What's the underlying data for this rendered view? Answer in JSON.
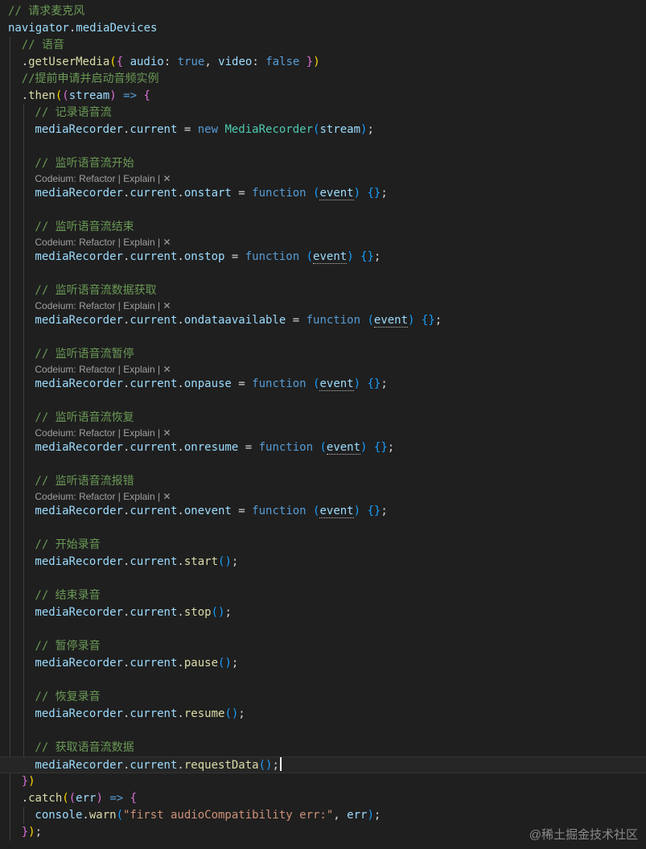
{
  "editor": {
    "lines": [
      {
        "kind": "code",
        "indent": 0,
        "tokens": [
          [
            "t-comment",
            "// 请求麦克风"
          ]
        ]
      },
      {
        "kind": "code",
        "indent": 0,
        "tokens": [
          [
            "t-var",
            "navigator"
          ],
          [
            "t-op",
            "."
          ],
          [
            "t-prop",
            "mediaDevices"
          ]
        ]
      },
      {
        "kind": "code",
        "indent": 1,
        "tokens": [
          [
            "t-comment",
            "// 语音"
          ]
        ]
      },
      {
        "kind": "code",
        "indent": 1,
        "tokens": [
          [
            "t-op",
            "."
          ],
          [
            "t-fn",
            "getUserMedia"
          ],
          [
            "t-b1",
            "("
          ],
          [
            "t-b2",
            "{ "
          ],
          [
            "t-prop",
            "audio"
          ],
          [
            "t-op",
            ": "
          ],
          [
            "t-kw",
            "true"
          ],
          [
            "t-op",
            ", "
          ],
          [
            "t-prop",
            "video"
          ],
          [
            "t-op",
            ": "
          ],
          [
            "t-kw",
            "false"
          ],
          [
            "t-b2",
            " }"
          ],
          [
            "t-b1",
            ")"
          ]
        ]
      },
      {
        "kind": "code",
        "indent": 1,
        "tokens": [
          [
            "t-comment",
            "//提前申请并启动音频实例"
          ]
        ]
      },
      {
        "kind": "code",
        "indent": 1,
        "tokens": [
          [
            "t-op",
            "."
          ],
          [
            "t-fn",
            "then"
          ],
          [
            "t-b1",
            "("
          ],
          [
            "t-b2",
            "("
          ],
          [
            "t-param",
            "stream"
          ],
          [
            "t-b2",
            ")"
          ],
          [
            "t-kw",
            " => "
          ],
          [
            "t-b2",
            "{"
          ]
        ]
      },
      {
        "kind": "code",
        "indent": 2,
        "tokens": [
          [
            "t-comment",
            "// 记录语音流"
          ]
        ]
      },
      {
        "kind": "code",
        "indent": 2,
        "tokens": [
          [
            "t-var",
            "mediaRecorder"
          ],
          [
            "t-op",
            "."
          ],
          [
            "t-prop",
            "current"
          ],
          [
            "t-op",
            " = "
          ],
          [
            "t-kw",
            "new "
          ],
          [
            "t-type",
            "MediaRecorder"
          ],
          [
            "t-b3",
            "("
          ],
          [
            "t-var",
            "stream"
          ],
          [
            "t-b3",
            ")"
          ],
          [
            "t-op",
            ";"
          ]
        ]
      },
      {
        "kind": "blank",
        "indent": 2
      },
      {
        "kind": "code",
        "indent": 2,
        "tokens": [
          [
            "t-comment",
            "// 监听语音流开始"
          ]
        ]
      },
      {
        "kind": "lens",
        "indent": 2
      },
      {
        "kind": "code",
        "indent": 2,
        "tokens": [
          [
            "t-var",
            "mediaRecorder"
          ],
          [
            "t-op",
            "."
          ],
          [
            "t-prop",
            "current"
          ],
          [
            "t-op",
            "."
          ],
          [
            "t-prop",
            "onstart"
          ],
          [
            "t-op",
            " = "
          ],
          [
            "t-kw",
            "function "
          ],
          [
            "t-b3",
            "("
          ],
          [
            "t-hint",
            "event"
          ],
          [
            "t-b3",
            ")"
          ],
          [
            "t-op",
            " "
          ],
          [
            "t-b3",
            "{}"
          ],
          [
            "t-op",
            ";"
          ]
        ]
      },
      {
        "kind": "blank",
        "indent": 2
      },
      {
        "kind": "code",
        "indent": 2,
        "tokens": [
          [
            "t-comment",
            "// 监听语音流结束"
          ]
        ]
      },
      {
        "kind": "lens",
        "indent": 2
      },
      {
        "kind": "code",
        "indent": 2,
        "tokens": [
          [
            "t-var",
            "mediaRecorder"
          ],
          [
            "t-op",
            "."
          ],
          [
            "t-prop",
            "current"
          ],
          [
            "t-op",
            "."
          ],
          [
            "t-prop",
            "onstop"
          ],
          [
            "t-op",
            " = "
          ],
          [
            "t-kw",
            "function "
          ],
          [
            "t-b3",
            "("
          ],
          [
            "t-hint",
            "event"
          ],
          [
            "t-b3",
            ")"
          ],
          [
            "t-op",
            " "
          ],
          [
            "t-b3",
            "{}"
          ],
          [
            "t-op",
            ";"
          ]
        ]
      },
      {
        "kind": "blank",
        "indent": 2
      },
      {
        "kind": "code",
        "indent": 2,
        "tokens": [
          [
            "t-comment",
            "// 监听语音流数据获取"
          ]
        ]
      },
      {
        "kind": "lens",
        "indent": 2
      },
      {
        "kind": "code",
        "indent": 2,
        "tokens": [
          [
            "t-var",
            "mediaRecorder"
          ],
          [
            "t-op",
            "."
          ],
          [
            "t-prop",
            "current"
          ],
          [
            "t-op",
            "."
          ],
          [
            "t-prop",
            "ondataavailable"
          ],
          [
            "t-op",
            " = "
          ],
          [
            "t-kw",
            "function "
          ],
          [
            "t-b3",
            "("
          ],
          [
            "t-hint",
            "event"
          ],
          [
            "t-b3",
            ")"
          ],
          [
            "t-op",
            " "
          ],
          [
            "t-b3",
            "{}"
          ],
          [
            "t-op",
            ";"
          ]
        ]
      },
      {
        "kind": "blank",
        "indent": 2
      },
      {
        "kind": "code",
        "indent": 2,
        "tokens": [
          [
            "t-comment",
            "// 监听语音流暂停"
          ]
        ]
      },
      {
        "kind": "lens",
        "indent": 2
      },
      {
        "kind": "code",
        "indent": 2,
        "tokens": [
          [
            "t-var",
            "mediaRecorder"
          ],
          [
            "t-op",
            "."
          ],
          [
            "t-prop",
            "current"
          ],
          [
            "t-op",
            "."
          ],
          [
            "t-prop",
            "onpause"
          ],
          [
            "t-op",
            " = "
          ],
          [
            "t-kw",
            "function "
          ],
          [
            "t-b3",
            "("
          ],
          [
            "t-hint",
            "event"
          ],
          [
            "t-b3",
            ")"
          ],
          [
            "t-op",
            " "
          ],
          [
            "t-b3",
            "{}"
          ],
          [
            "t-op",
            ";"
          ]
        ]
      },
      {
        "kind": "blank",
        "indent": 2
      },
      {
        "kind": "code",
        "indent": 2,
        "tokens": [
          [
            "t-comment",
            "// 监听语音流恢复"
          ]
        ]
      },
      {
        "kind": "lens",
        "indent": 2
      },
      {
        "kind": "code",
        "indent": 2,
        "tokens": [
          [
            "t-var",
            "mediaRecorder"
          ],
          [
            "t-op",
            "."
          ],
          [
            "t-prop",
            "current"
          ],
          [
            "t-op",
            "."
          ],
          [
            "t-prop",
            "onresume"
          ],
          [
            "t-op",
            " = "
          ],
          [
            "t-kw",
            "function "
          ],
          [
            "t-b3",
            "("
          ],
          [
            "t-hint",
            "event"
          ],
          [
            "t-b3",
            ")"
          ],
          [
            "t-op",
            " "
          ],
          [
            "t-b3",
            "{}"
          ],
          [
            "t-op",
            ";"
          ]
        ]
      },
      {
        "kind": "blank",
        "indent": 2
      },
      {
        "kind": "code",
        "indent": 2,
        "tokens": [
          [
            "t-comment",
            "// 监听语音流报错"
          ]
        ]
      },
      {
        "kind": "lens",
        "indent": 2
      },
      {
        "kind": "code",
        "indent": 2,
        "tokens": [
          [
            "t-var",
            "mediaRecorder"
          ],
          [
            "t-op",
            "."
          ],
          [
            "t-prop",
            "current"
          ],
          [
            "t-op",
            "."
          ],
          [
            "t-prop",
            "onevent"
          ],
          [
            "t-op",
            " = "
          ],
          [
            "t-kw",
            "function "
          ],
          [
            "t-b3",
            "("
          ],
          [
            "t-hint",
            "event"
          ],
          [
            "t-b3",
            ")"
          ],
          [
            "t-op",
            " "
          ],
          [
            "t-b3",
            "{}"
          ],
          [
            "t-op",
            ";"
          ]
        ]
      },
      {
        "kind": "blank",
        "indent": 2
      },
      {
        "kind": "code",
        "indent": 2,
        "tokens": [
          [
            "t-comment",
            "// 开始录音"
          ]
        ]
      },
      {
        "kind": "code",
        "indent": 2,
        "tokens": [
          [
            "t-var",
            "mediaRecorder"
          ],
          [
            "t-op",
            "."
          ],
          [
            "t-prop",
            "current"
          ],
          [
            "t-op",
            "."
          ],
          [
            "t-fn",
            "start"
          ],
          [
            "t-b3",
            "()"
          ],
          [
            "t-op",
            ";"
          ]
        ]
      },
      {
        "kind": "blank",
        "indent": 2
      },
      {
        "kind": "code",
        "indent": 2,
        "tokens": [
          [
            "t-comment",
            "// 结束录音"
          ]
        ]
      },
      {
        "kind": "code",
        "indent": 2,
        "tokens": [
          [
            "t-var",
            "mediaRecorder"
          ],
          [
            "t-op",
            "."
          ],
          [
            "t-prop",
            "current"
          ],
          [
            "t-op",
            "."
          ],
          [
            "t-fn",
            "stop"
          ],
          [
            "t-b3",
            "()"
          ],
          [
            "t-op",
            ";"
          ]
        ]
      },
      {
        "kind": "blank",
        "indent": 2
      },
      {
        "kind": "code",
        "indent": 2,
        "tokens": [
          [
            "t-comment",
            "// 暂停录音"
          ]
        ]
      },
      {
        "kind": "code",
        "indent": 2,
        "tokens": [
          [
            "t-var",
            "mediaRecorder"
          ],
          [
            "t-op",
            "."
          ],
          [
            "t-prop",
            "current"
          ],
          [
            "t-op",
            "."
          ],
          [
            "t-fn",
            "pause"
          ],
          [
            "t-b3",
            "()"
          ],
          [
            "t-op",
            ";"
          ]
        ]
      },
      {
        "kind": "blank",
        "indent": 2
      },
      {
        "kind": "code",
        "indent": 2,
        "tokens": [
          [
            "t-comment",
            "// 恢复录音"
          ]
        ]
      },
      {
        "kind": "code",
        "indent": 2,
        "tokens": [
          [
            "t-var",
            "mediaRecorder"
          ],
          [
            "t-op",
            "."
          ],
          [
            "t-prop",
            "current"
          ],
          [
            "t-op",
            "."
          ],
          [
            "t-fn",
            "resume"
          ],
          [
            "t-b3",
            "()"
          ],
          [
            "t-op",
            ";"
          ]
        ]
      },
      {
        "kind": "blank",
        "indent": 2
      },
      {
        "kind": "code",
        "indent": 2,
        "tokens": [
          [
            "t-comment",
            "// 获取语音流数据"
          ]
        ]
      },
      {
        "kind": "code",
        "indent": 2,
        "current": true,
        "tokens": [
          [
            "t-var",
            "mediaRecorder"
          ],
          [
            "t-op",
            "."
          ],
          [
            "t-prop",
            "current"
          ],
          [
            "t-op",
            "."
          ],
          [
            "t-fn",
            "requestData"
          ],
          [
            "t-b3",
            "()"
          ],
          [
            "t-op",
            ";"
          ]
        ]
      },
      {
        "kind": "code",
        "indent": 1,
        "tokens": [
          [
            "t-b2",
            "}"
          ],
          [
            "t-b1",
            ")"
          ]
        ]
      },
      {
        "kind": "code",
        "indent": 1,
        "tokens": [
          [
            "t-op",
            "."
          ],
          [
            "t-fn",
            "catch"
          ],
          [
            "t-b1",
            "("
          ],
          [
            "t-b2",
            "("
          ],
          [
            "t-param",
            "err"
          ],
          [
            "t-b2",
            ")"
          ],
          [
            "t-kw",
            " => "
          ],
          [
            "t-b2",
            "{"
          ]
        ]
      },
      {
        "kind": "code",
        "indent": 2,
        "tokens": [
          [
            "t-var",
            "console"
          ],
          [
            "t-op",
            "."
          ],
          [
            "t-fn",
            "warn"
          ],
          [
            "t-b3",
            "("
          ],
          [
            "t-str",
            "\"first audioCompatibility err:\""
          ],
          [
            "t-op",
            ", "
          ],
          [
            "t-var",
            "err"
          ],
          [
            "t-b3",
            ")"
          ],
          [
            "t-op",
            ";"
          ]
        ]
      },
      {
        "kind": "code",
        "indent": 1,
        "tokens": [
          [
            "t-b2",
            "}"
          ],
          [
            "t-b1",
            ")"
          ],
          [
            "t-op",
            ";"
          ]
        ]
      }
    ]
  },
  "codelens": {
    "prefix": "Codeium:",
    "refactor": "Refactor",
    "separator": "|",
    "explain": "Explain",
    "close": "✕"
  },
  "watermark": "@稀土掘金技术社区"
}
